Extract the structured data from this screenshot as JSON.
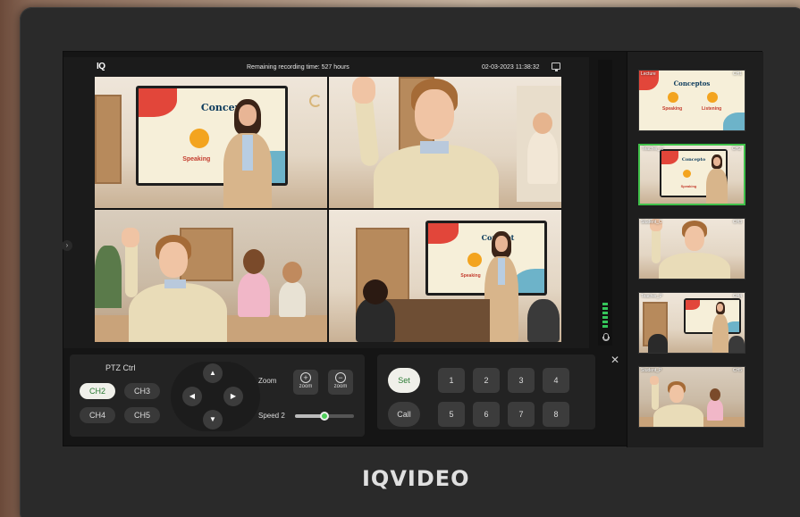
{
  "topbar": {
    "logo": "IQ",
    "recording": "Remaining recording time: 527 hours",
    "datetime": "02-03-2023 11:38:32",
    "monitor_icon": "monitor-icon"
  },
  "main_view": {
    "tiles": [
      {
        "board_title": "Concept",
        "board_label": "Speaking"
      },
      {},
      {},
      {
        "board_title": "Concept",
        "board_label": "Speaking"
      }
    ]
  },
  "audio_meter": {
    "level": 0.3,
    "icon": "mic-icon"
  },
  "thumbnails": [
    {
      "name": "Lecture",
      "channel": "CH1",
      "board_title": "Conceptos",
      "labels": [
        "Speaking",
        "Listening"
      ],
      "active": false
    },
    {
      "name": "Teacher_C",
      "channel": "CH2",
      "board_title": "Concepto",
      "labels": [
        "Speaking"
      ],
      "active": true
    },
    {
      "name": "Student_C",
      "channel": "CH3",
      "active": false
    },
    {
      "name": "Teacher_P",
      "channel": "CH4",
      "active": false
    },
    {
      "name": "Student_P",
      "channel": "CH5",
      "active": false
    }
  ],
  "ptz": {
    "title": "PTZ Ctrl",
    "channels": [
      "CH2",
      "CH3",
      "CH4",
      "CH5"
    ],
    "selected_channel": "CH2",
    "zoom_label": "Zoom",
    "zoom_in": "zoom",
    "zoom_out": "zoom",
    "speed_label": "Speed",
    "speed_value": "2",
    "speed_fraction": 0.5
  },
  "presets": {
    "set_label": "Set",
    "call_label": "Call",
    "numbers": [
      "1",
      "2",
      "3",
      "4",
      "5",
      "6",
      "7",
      "8"
    ]
  },
  "brand": "IQVIDEO",
  "colors": {
    "accent_green": "#40c04a",
    "meter_green": "#35c55a"
  }
}
